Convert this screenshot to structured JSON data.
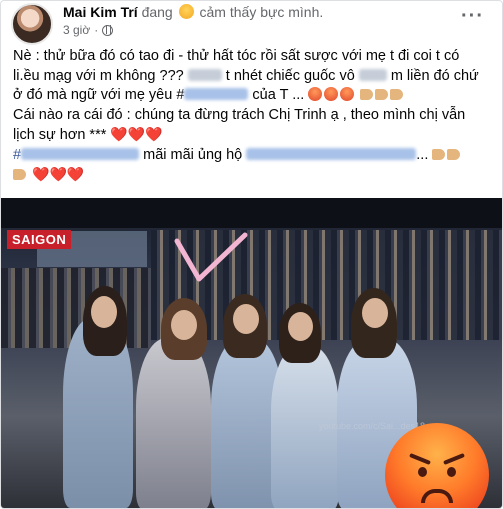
{
  "post": {
    "author": "Mai Kim Trí",
    "feeling_prefix": "đang",
    "feeling_text": "cảm thấy bực mình.",
    "time": "3 giờ",
    "more_label": "···",
    "line1": "Nè : thử bữa đó có tao đi - thử hất tóc  rồi sất sược với mẹ t đi coi t có",
    "line2a": "li.ều mạg với m không ???",
    "line2b": "t nhét chiếc guốc vô",
    "line2c": "m liền đó chứ",
    "line3a": "ở đó mà ngữ với mẹ yêu #",
    "line3b": "của T ...",
    "line4": "Cái nào ra cái đó : chúng ta đừng trách Chị Trinh ạ , theo mình chị vẫn",
    "line5": "lịch sự hơn ***",
    "line6a": "#",
    "line6b": "mãi mãi ủng hộ",
    "line6c": "...",
    "hearts": "❤️❤️❤️",
    "hearts2": "❤️❤️❤️"
  },
  "photo": {
    "channel_logo": "SAIGON",
    "watermark": "youtube.com/c/Sai...des18"
  },
  "colors": {
    "link": "#385898",
    "meta": "#65676b",
    "heart": "#e41b3d",
    "logo_bg": "#c7202a"
  },
  "icons": [
    "angry-emoji-icon",
    "globe-icon",
    "more-icon",
    "heart-icon",
    "hand-icon",
    "arrow-annotation-icon"
  ]
}
